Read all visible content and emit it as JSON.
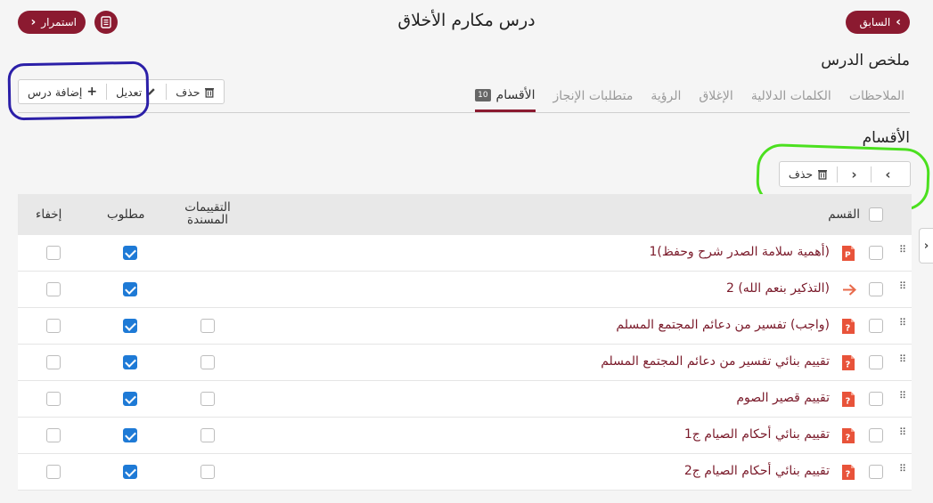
{
  "header": {
    "title": "درس مكارم الأخلاق",
    "prev_label": "السابق",
    "continue_label": "استمرار"
  },
  "summary_title": "ملخص الدرس",
  "tabs": [
    {
      "label": "الأقسام",
      "count": "10",
      "active": true
    },
    {
      "label": "متطلبات الإنجاز"
    },
    {
      "label": "الرؤية"
    },
    {
      "label": "الإغلاق"
    },
    {
      "label": "الكلمات الدلالية"
    },
    {
      "label": "الملاحظات"
    }
  ],
  "toolbar": {
    "add_label": "إضافة درس",
    "edit_label": "تعديل",
    "delete_label": "حذف"
  },
  "sections": {
    "title": "الأقسام",
    "delete_label": "حذف",
    "columns": {
      "section": "القسم",
      "assessments_line1": "التقييمات",
      "assessments_line2": "المسندة",
      "required": "مطلوب",
      "hide": "إخفاء"
    },
    "rows": [
      {
        "title": "(أهمية سلامة الصدر شرح وحفظ)1",
        "icon": "powerpoint-icon",
        "assess": null,
        "required": true,
        "hide": false
      },
      {
        "title": "(التذكير بنعم الله) 2",
        "icon": "arrow-link-icon",
        "assess": null,
        "required": true,
        "hide": false
      },
      {
        "title": "(واجب) تفسير من دعائم المجتمع المسلم",
        "icon": "quiz-icon",
        "assess": false,
        "required": true,
        "hide": false
      },
      {
        "title": "تقييم بنائي تفسير من دعائم المجتمع المسلم",
        "icon": "quiz-icon",
        "assess": false,
        "required": true,
        "hide": false
      },
      {
        "title": "تقييم قصير الصوم",
        "icon": "quiz-icon",
        "assess": false,
        "required": true,
        "hide": false
      },
      {
        "title": "تقييم بنائي أحكام الصيام ج1",
        "icon": "quiz-icon",
        "assess": false,
        "required": true,
        "hide": false
      },
      {
        "title": "تقييم بنائي أحكام الصيام ج2",
        "icon": "quiz-icon",
        "assess": false,
        "required": true,
        "hide": false
      }
    ]
  },
  "colors": {
    "brand": "#8b1a30",
    "checkbox_checked": "#1e7ad6",
    "item_text": "#7a1a2a",
    "annotation_blue": "#2b1fa8",
    "annotation_green": "#4be01f"
  }
}
